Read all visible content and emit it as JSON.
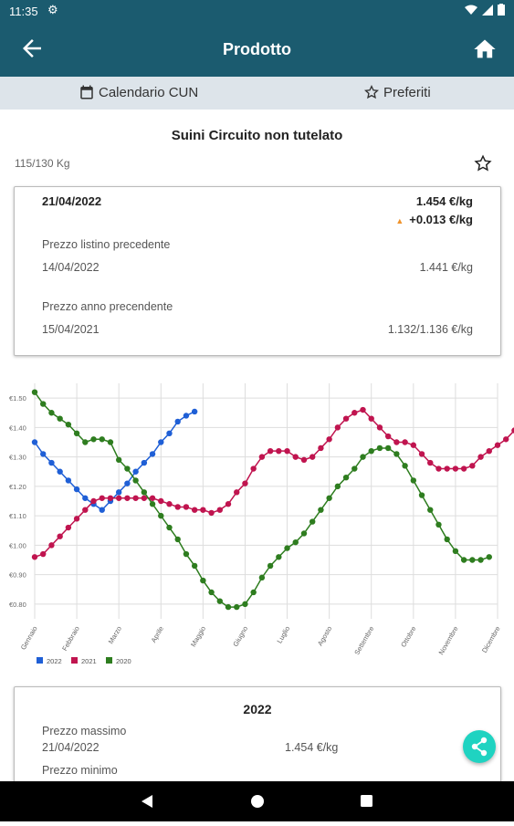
{
  "status_bar": {
    "time": "11:35"
  },
  "app_bar": {
    "title": "Prodotto"
  },
  "tabs": [
    {
      "label": "Calendario CUN",
      "icon": "calendar-icon"
    },
    {
      "label": "Preferiti",
      "icon": "star-outline-icon"
    }
  ],
  "product": {
    "name": "Suini Circuito non tutelato",
    "weight": "115/130 Kg"
  },
  "price_card": {
    "date": "21/04/2022",
    "price": "1.454 €/kg",
    "delta": "+0.013 €/kg",
    "prev_list_label": "Prezzo listino precedente",
    "prev_list_date": "14/04/2022",
    "prev_list_price": "1.441 €/kg",
    "prev_year_label": "Prezzo anno precendente",
    "prev_year_date": "15/04/2021",
    "prev_year_price": "1.132/1.136 €/kg"
  },
  "chart_data": {
    "type": "line",
    "x": [
      "Gennaio",
      "Febbraio",
      "Marzo",
      "Aprile",
      "Maggio",
      "Giugno",
      "Luglio",
      "Agosto",
      "Settembre",
      "Ottobre",
      "Novembre",
      "Dicembre"
    ],
    "yticks": [
      "€1.50",
      "€1.40",
      "€1.30",
      "€1.20",
      "€1.10",
      "€1.00",
      "€0.90",
      "€0.80"
    ],
    "ylim": [
      0.75,
      1.55
    ],
    "grid": true,
    "legend_position": "bottom-left",
    "series": [
      {
        "name": "2022",
        "color": "#1f5fd6",
        "values": [
          1.35,
          1.31,
          1.28,
          1.25,
          1.22,
          1.19,
          1.16,
          1.14,
          1.12,
          1.15,
          1.18,
          1.21,
          1.25,
          1.28,
          1.31,
          1.35,
          1.38,
          1.42,
          1.44,
          1.454
        ]
      },
      {
        "name": "2021",
        "color": "#c0144f",
        "values": [
          0.96,
          0.97,
          1.0,
          1.03,
          1.06,
          1.09,
          1.12,
          1.15,
          1.16,
          1.16,
          1.16,
          1.16,
          1.16,
          1.16,
          1.16,
          1.15,
          1.14,
          1.13,
          1.13,
          1.12,
          1.12,
          1.11,
          1.12,
          1.14,
          1.18,
          1.21,
          1.26,
          1.3,
          1.32,
          1.32,
          1.32,
          1.3,
          1.29,
          1.3,
          1.33,
          1.36,
          1.4,
          1.43,
          1.45,
          1.46,
          1.43,
          1.4,
          1.37,
          1.35,
          1.35,
          1.34,
          1.31,
          1.28,
          1.26,
          1.26,
          1.26,
          1.26,
          1.27,
          1.3,
          1.32,
          1.34,
          1.36,
          1.39,
          1.41,
          1.38
        ]
      },
      {
        "name": "2020",
        "color": "#2e7d1f",
        "values": [
          1.52,
          1.48,
          1.45,
          1.43,
          1.41,
          1.38,
          1.35,
          1.36,
          1.36,
          1.35,
          1.29,
          1.26,
          1.22,
          1.18,
          1.14,
          1.1,
          1.06,
          1.02,
          0.97,
          0.93,
          0.88,
          0.84,
          0.81,
          0.79,
          0.79,
          0.8,
          0.84,
          0.89,
          0.93,
          0.96,
          0.99,
          1.01,
          1.04,
          1.08,
          1.12,
          1.16,
          1.2,
          1.23,
          1.26,
          1.3,
          1.32,
          1.33,
          1.33,
          1.31,
          1.27,
          1.22,
          1.17,
          1.12,
          1.07,
          1.02,
          0.98,
          0.95,
          0.95,
          0.95,
          0.96
        ]
      }
    ]
  },
  "year_card": {
    "year": "2022",
    "max_label": "Prezzo massimo",
    "max_date": "21/04/2022",
    "max_price": "1.454 €/kg",
    "min_label": "Prezzo minimo"
  }
}
